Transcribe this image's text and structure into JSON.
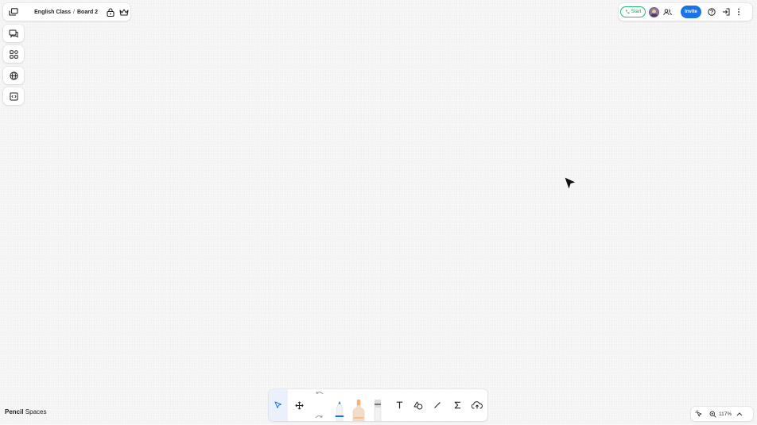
{
  "breadcrumb": {
    "class_name": "English Class",
    "separator": "/",
    "board_name": "Board 2"
  },
  "topright": {
    "start_label": "Start",
    "invite_label": "Invite"
  },
  "sidebar": {
    "items": [
      {
        "icon": "chat-icon"
      },
      {
        "icon": "apps-grid-icon"
      },
      {
        "icon": "globe-icon"
      },
      {
        "icon": "embed-code-icon"
      }
    ]
  },
  "toolbar": {
    "tools": [
      "select",
      "move",
      "undo",
      "redo",
      "pen-blue",
      "highlighter-orange",
      "eraser",
      "text",
      "shapes",
      "line",
      "math",
      "upload"
    ]
  },
  "brand": {
    "bold": "Pencil",
    "rest": " Spaces"
  },
  "zoom": {
    "level": "117%"
  },
  "colors": {
    "accent": "#1a73e8",
    "start_green": "#2ab673",
    "pen_blue": "#1a73e8",
    "highlighter_orange": "#f5b072"
  }
}
